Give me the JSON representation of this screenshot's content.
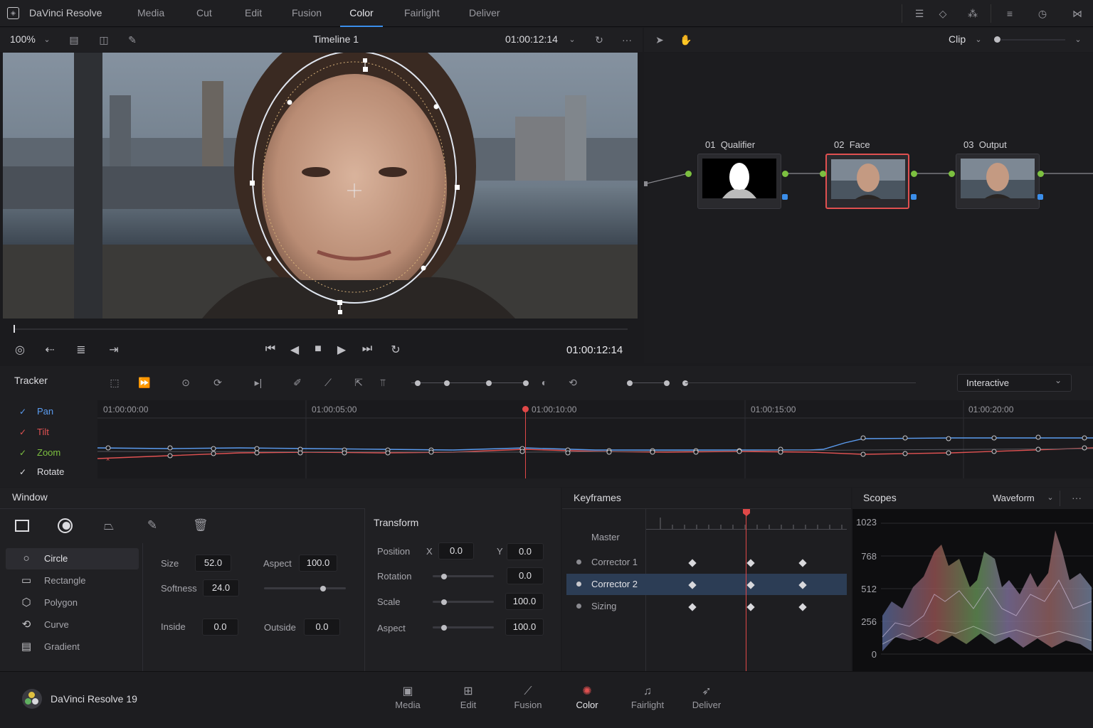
{
  "app": {
    "title": "DaVinci Resolve",
    "version_label": "DaVinci Resolve 19"
  },
  "top_tabs": [
    "Media",
    "Cut",
    "Edit",
    "Fusion",
    "Color",
    "Fairlight",
    "Deliver"
  ],
  "active_tab": "Color",
  "viewer": {
    "zoom": "100%",
    "timeline_name": "Timeline 1",
    "timecode_top": "01:00:12:14",
    "timecode_transport": "01:00:12:14"
  },
  "node_bar": {
    "mode": "Clip"
  },
  "nodes": [
    {
      "id": "01",
      "name": "Qualifier"
    },
    {
      "id": "02",
      "name": "Face"
    },
    {
      "id": "03",
      "name": "Output"
    }
  ],
  "tracker": {
    "title": "Tracker",
    "mode": "Interactive",
    "params": [
      {
        "label": "Pan",
        "color": "#5b9cf0"
      },
      {
        "label": "Tilt",
        "color": "#e05252"
      },
      {
        "label": "Zoom",
        "color": "#7cc040"
      },
      {
        "label": "Rotate",
        "color": "#dcdce0"
      }
    ],
    "ruler": [
      "01:00:00:00",
      "01:00:05:00",
      "01:00:10:00",
      "01:00:15:00",
      "01:00:20:00"
    ]
  },
  "window_panel": {
    "title": "Window",
    "shapes": [
      "Circle",
      "Rectangle",
      "Polygon",
      "Curve",
      "Gradient"
    ],
    "size_label": "Size",
    "size": "52.0",
    "aspect_label": "Aspect",
    "aspect": "100.0",
    "softness_label": "Softness",
    "softness": "24.0",
    "inside_label": "Inside",
    "inside": "0.0",
    "outside_label": "Outside",
    "outside": "0.0"
  },
  "transform": {
    "title": "Transform",
    "position_label": "Position",
    "x_label": "X",
    "x": "0.0",
    "y_label": "Y",
    "y": "0.0",
    "rotation_label": "Rotation",
    "rotation": "0.0",
    "scale_label": "Scale",
    "scale": "100.0",
    "aspect_label": "Aspect",
    "aspect": "100.0"
  },
  "keyframes": {
    "title": "Keyframes",
    "rows": [
      "Master",
      "Corrector 1",
      "Corrector 2",
      "Sizing"
    ]
  },
  "scopes": {
    "title": "Scopes",
    "mode": "Waveform",
    "axis": [
      "1023",
      "768",
      "512",
      "256",
      "0"
    ]
  },
  "bottom_nav": [
    "Media",
    "Edit",
    "Fusion",
    "Color",
    "Fairlight",
    "Deliver"
  ],
  "colors": {
    "accent": "#3b8eea",
    "playhead": "#e04848",
    "node_active": "#e05050"
  }
}
